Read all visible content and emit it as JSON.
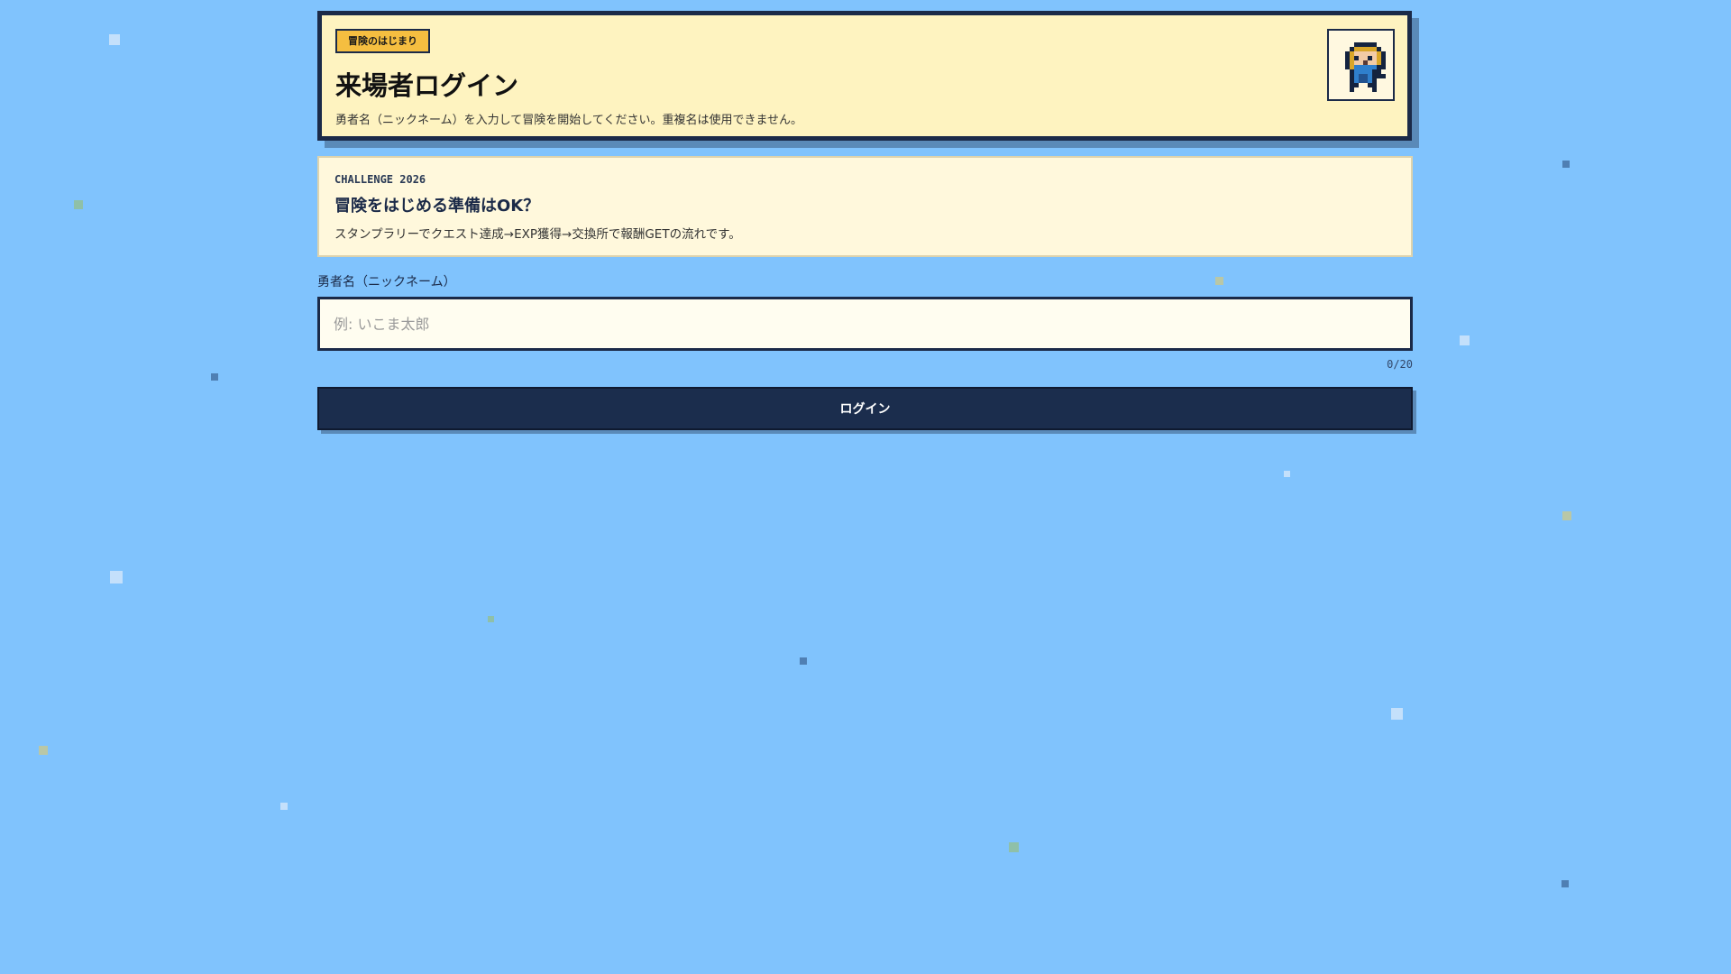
{
  "header": {
    "badge": "冒険のはじまり",
    "title": "来場者ログイン",
    "subtitle": "勇者名（ニックネーム）を入力して冒険を開始してください。重複名は使用できません。"
  },
  "card": {
    "kicker": "CHALLENGE 2026",
    "heading": "冒険をはじめる準備はOK？",
    "text": "スタンプラリーでクエスト達成→EXP獲得→交換所で報酬GETの流れです。"
  },
  "form": {
    "label": "勇者名（ニックネーム）",
    "value": "",
    "placeholder": "例: いこま太郎",
    "counter": "0/20",
    "submit": "ログイン"
  },
  "colors": {
    "background": "#80c3fd",
    "navy": "#1b2d4d",
    "badge": "#f5be40",
    "panel": "#fef3c0"
  }
}
